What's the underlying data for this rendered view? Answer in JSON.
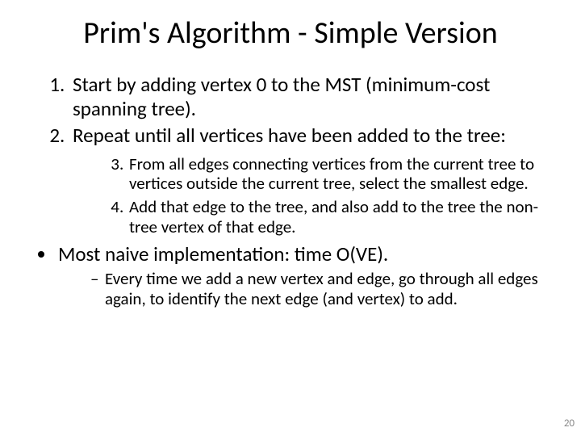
{
  "title": "Prim's Algorithm - Simple Version",
  "steps": {
    "s1": "Start by adding vertex 0 to the MST (minimum-cost spanning tree).",
    "s2": "Repeat until all vertices have been added to the tree:",
    "s3": "From all edges connecting vertices from the current tree to vertices outside the current tree, select the smallest edge.",
    "s4": "Add that edge to the tree, and also add to the tree the non-tree vertex of that edge."
  },
  "note": {
    "line": "Most naive implementation: time O(VE).",
    "sub": "Every time we add a new vertex and edge, go through all edges again, to identify the next edge (and vertex) to add."
  },
  "pageNumber": "20"
}
